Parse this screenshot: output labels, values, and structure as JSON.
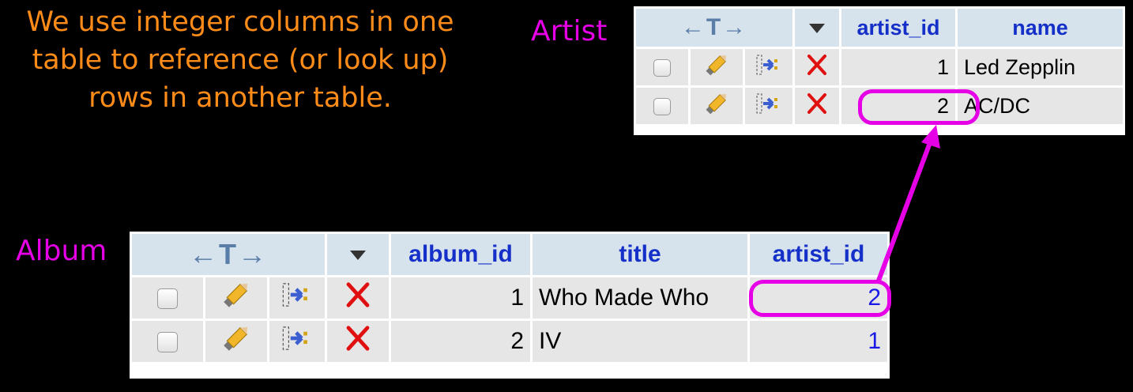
{
  "caption": {
    "line1": "We use integer columns in one",
    "line2": "table to reference (or look up)",
    "line3": "rows in another table."
  },
  "artist_table": {
    "label": "Artist",
    "control_header": "←T→",
    "columns": [
      "artist_id",
      "name"
    ],
    "rows": [
      {
        "artist_id": "1",
        "name": "Led Zepplin"
      },
      {
        "artist_id": "2",
        "name": "AC/DC"
      }
    ]
  },
  "album_table": {
    "label": "Album",
    "control_header": "←T→",
    "columns": [
      "album_id",
      "title",
      "artist_id"
    ],
    "rows": [
      {
        "album_id": "1",
        "title": "Who Made Who",
        "artist_id": "2"
      },
      {
        "album_id": "2",
        "title": "IV",
        "artist_id": "1"
      }
    ]
  },
  "colors": {
    "caption": "#ff8c19",
    "highlight": "#e600e6",
    "header_text": "#1530c8",
    "fk_value": "#1a1ae6",
    "delete_icon": "#e01010"
  },
  "icons": [
    "checkbox-icon",
    "pencil-edit-icon",
    "copy-row-icon",
    "delete-x-icon",
    "sort-dropdown-icon"
  ]
}
